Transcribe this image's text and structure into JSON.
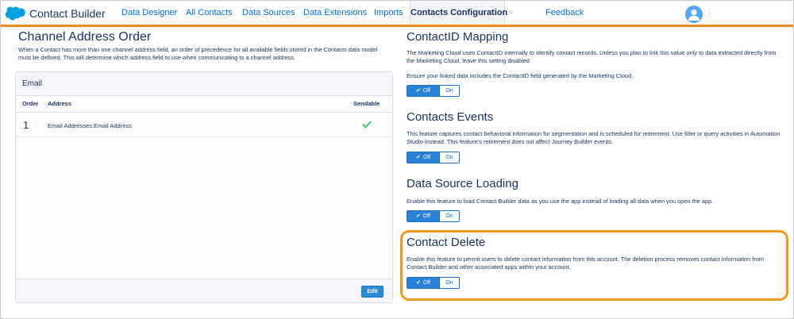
{
  "app": {
    "name": "Contact Builder"
  },
  "nav": {
    "tabs": [
      {
        "label": "Data Designer"
      },
      {
        "label": "All Contacts"
      },
      {
        "label": "Data Sources"
      },
      {
        "label": "Data Extensions"
      },
      {
        "label": "Imports"
      },
      {
        "label": "Contacts Configuration",
        "active": true
      },
      {
        "label": "Feedback"
      }
    ],
    "more_glyph": "»",
    "avatar_menu_glyph": "⋮"
  },
  "channel": {
    "title": "Channel Address Order",
    "description": "When a Contact has more than one channel address field, an order of precedence for all available fields stored in the Contacts data model must be defined. This will determine which address field to use when communicating to a channel address.",
    "card": {
      "title": "Email",
      "columns": [
        "Order",
        "Address",
        "Sendable"
      ],
      "rows": [
        {
          "order": "1",
          "address": "Email Addresses.Email Address",
          "sendable": true
        }
      ],
      "edit_label": "Edit"
    }
  },
  "sections": [
    {
      "title": "ContactID Mapping",
      "paragraphs": [
        "The Marketing Cloud uses ContactID internally to identify contact records. Unless you plan to link this value only to data extracted directly from the Marketing Cloud, leave this setting disabled.",
        "Ensure your linked data includes the ContactID field generated by the Marketing Cloud."
      ],
      "toggle": {
        "off_label": "Off",
        "on_label": "On",
        "state": "off"
      }
    },
    {
      "title": "Contacts Events",
      "paragraphs": [
        "This feature captures contact behavioral information for segmentation and is scheduled for retirement. Use filter or query activities in Automation Studio instead. This feature's retirement does not affect Journey Builder events."
      ],
      "toggle": {
        "off_label": "Off",
        "on_label": "On",
        "state": "off"
      }
    },
    {
      "title": "Data Source Loading",
      "paragraphs": [
        "Enable this feature to load Contact Builder data as you use the app instead of loading all data when you open the app."
      ],
      "toggle": {
        "off_label": "Off",
        "on_label": "On",
        "state": "off"
      }
    },
    {
      "title": "Contact Delete",
      "paragraphs": [
        "Enable this feature to permit users to delete contact information from this account. The deletion process removes contact information from Contact Builder and other associated apps within your account."
      ],
      "toggle": {
        "off_label": "Off",
        "on_label": "On",
        "state": "off"
      },
      "highlighted": true
    }
  ],
  "colors": {
    "accent_orange": "#f28c1e",
    "brand_blue": "#0070d2",
    "toggle_blue": "#2a82d6",
    "check_green": "#4bca81",
    "text_navy": "#16325c"
  },
  "icons": {
    "brand": "salesforce-cloud-icon",
    "check": "check-icon",
    "avatar": "user-avatar-icon"
  }
}
